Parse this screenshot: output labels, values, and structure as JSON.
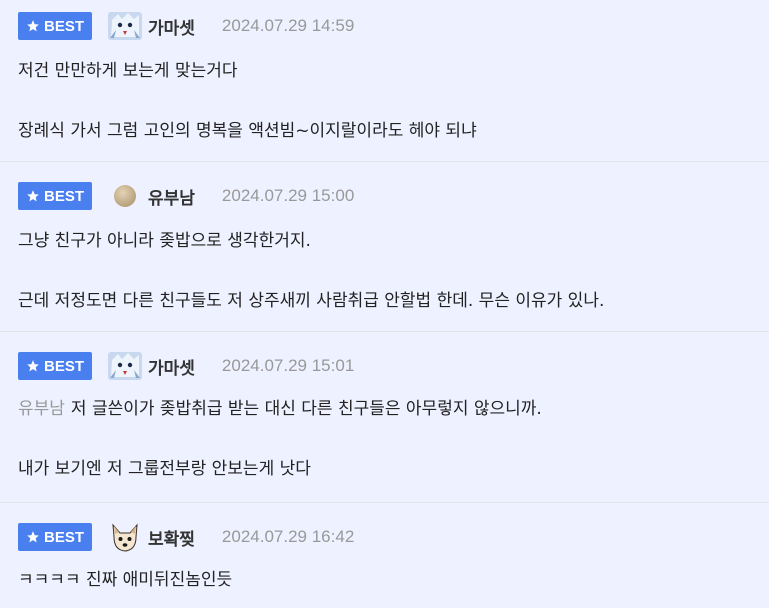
{
  "comments": [
    {
      "badge": "BEST",
      "avatar_icon": "ice-character-avatar-icon",
      "nickname": "가마셋",
      "datetime": "2024.07.29 14:59",
      "lines": [
        "저건 만만하게 보는게 맞는거다",
        "",
        "장례식 가서 그럼 고인의 명복을 액션빔~이지랄이라도 헤야 되냐"
      ]
    },
    {
      "badge": "BEST",
      "avatar_icon": "beige-circle-avatar-icon",
      "nickname": "유부남",
      "datetime": "2024.07.29 15:00",
      "lines": [
        "그냥 친구가 아니라 좆밥으로 생각한거지.",
        "",
        "근데 저정도면 다른 친구들도 저 상주새끼 사람취급 안할법 한데. 무슨 이유가 있나."
      ]
    },
    {
      "badge": "BEST",
      "avatar_icon": "ice-character-avatar-icon",
      "nickname": "가마셋",
      "datetime": "2024.07.29 15:01",
      "mention": "유부남",
      "lines": [
        "저 글쓴이가 좆밥취급 받는 대신 다른 친구들은 아무렇지 않으니까.",
        "",
        "내가 보기엔 저 그룹전부랑 안보는게 낫다"
      ]
    },
    {
      "badge": "BEST",
      "avatar_icon": "dog-face-avatar-icon",
      "nickname": "보확찢",
      "datetime": "2024.07.29 16:42",
      "lines": [
        "ㅋㅋㅋㅋ 진짜 애미뒤진놈인듯"
      ]
    }
  ],
  "colors": {
    "badge": "#4a7ff0",
    "row_bg": "#eef1ff",
    "date": "#999999",
    "mention": "#999999"
  }
}
